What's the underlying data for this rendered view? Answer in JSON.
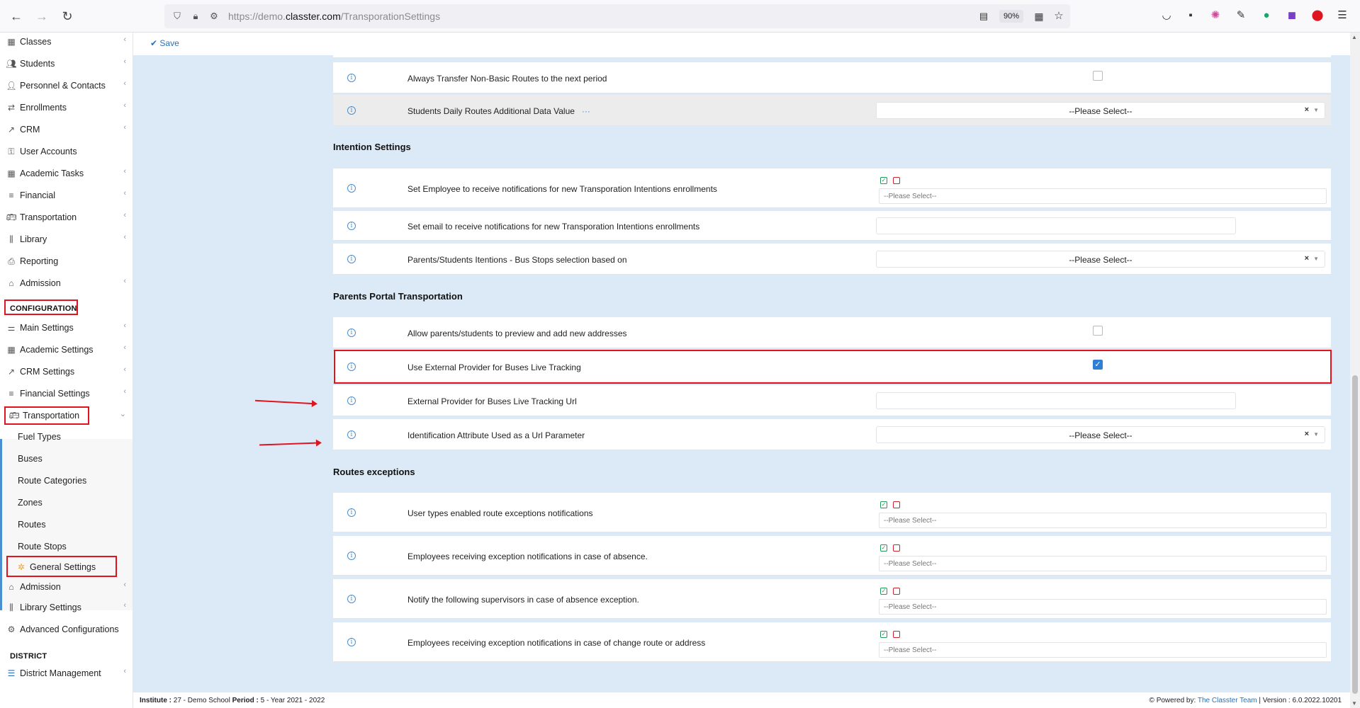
{
  "browser": {
    "url_prefix": "https://demo.",
    "url_host": "classter.com",
    "url_path": "/TransporationSettings",
    "zoom": "90%"
  },
  "sidebar": {
    "top_items": [
      {
        "label": "Classes",
        "icon": "classes-icon"
      },
      {
        "label": "Students",
        "icon": "students-icon"
      },
      {
        "label": "Personnel & Contacts",
        "icon": "personnel-icon"
      },
      {
        "label": "Enrollments",
        "icon": "enrollments-icon"
      },
      {
        "label": "CRM",
        "icon": "crm-icon"
      },
      {
        "label": "User Accounts",
        "icon": "key-icon"
      },
      {
        "label": "Academic Tasks",
        "icon": "tasks-icon"
      },
      {
        "label": "Financial",
        "icon": "financial-icon"
      },
      {
        "label": "Transportation",
        "icon": "bus-icon"
      },
      {
        "label": "Library",
        "icon": "library-icon"
      },
      {
        "label": "Reporting",
        "icon": "printer-icon"
      },
      {
        "label": "Admission",
        "icon": "admission-icon"
      }
    ],
    "configuration_title": "CONFIGURATION",
    "config_items": [
      {
        "label": "Main Settings"
      },
      {
        "label": "Academic Settings"
      },
      {
        "label": "CRM Settings"
      },
      {
        "label": "Financial Settings"
      },
      {
        "label": "Transportation"
      }
    ],
    "transport_sub": [
      {
        "label": "Fuel Types"
      },
      {
        "label": "Buses"
      },
      {
        "label": "Route Categories"
      },
      {
        "label": "Zones"
      },
      {
        "label": "Routes"
      },
      {
        "label": "Route Stops"
      },
      {
        "label": "General Settings"
      }
    ],
    "after_items": [
      {
        "label": "Admission"
      },
      {
        "label": "Library Settings"
      },
      {
        "label": "Advanced Configurations"
      }
    ],
    "district_title": "DISTRICT",
    "district_items": [
      {
        "label": "District Management"
      }
    ]
  },
  "toolbar": {
    "save_label": "Save"
  },
  "settings": {
    "row_nonbasic": "Always Transfer Non-Basic Routes to the next period",
    "row_daily": "Students Daily Routes Additional Data Value",
    "daily_dots": "···",
    "please_select": "--Please Select--",
    "intention_title": "Intention Settings",
    "row_intent_employee": "Set Employee to receive notifications for new Transporation Intentions enrollments",
    "row_intent_email": "Set email to receive notifications for new Transporation Intentions enrollments",
    "row_intent_busstops": "Parents/Students Itentions - Bus Stops selection based on",
    "portal_title": "Parents Portal Transportation",
    "row_preview_addr": "Allow parents/students to preview and add new addresses",
    "row_external": "Use External Provider for Buses Live Tracking",
    "row_external_url": "External Provider for Buses Live Tracking Url",
    "row_ident_attr": "Identification Attribute Used as a Url Parameter",
    "exceptions_title": "Routes exceptions",
    "row_user_types": "User types enabled route exceptions notifications",
    "row_emp_absence": "Employees receiving exception notifications in case of absence.",
    "row_supervisors": "Notify the following supervisors in case of absence exception.",
    "row_emp_change": "Employees receiving exception notifications in case of change route or address",
    "multi_placeholder": "--Please Select--"
  },
  "footer": {
    "institute_label": "Institute :",
    "institute_value": "27 - Demo School",
    "period_label": "Period :",
    "period_value": "5 - Year 2021 - 2022",
    "powered_label": "Powered by:",
    "powered_link": "The Classter Team",
    "version": "| Version : 6.0.2022.10201"
  }
}
